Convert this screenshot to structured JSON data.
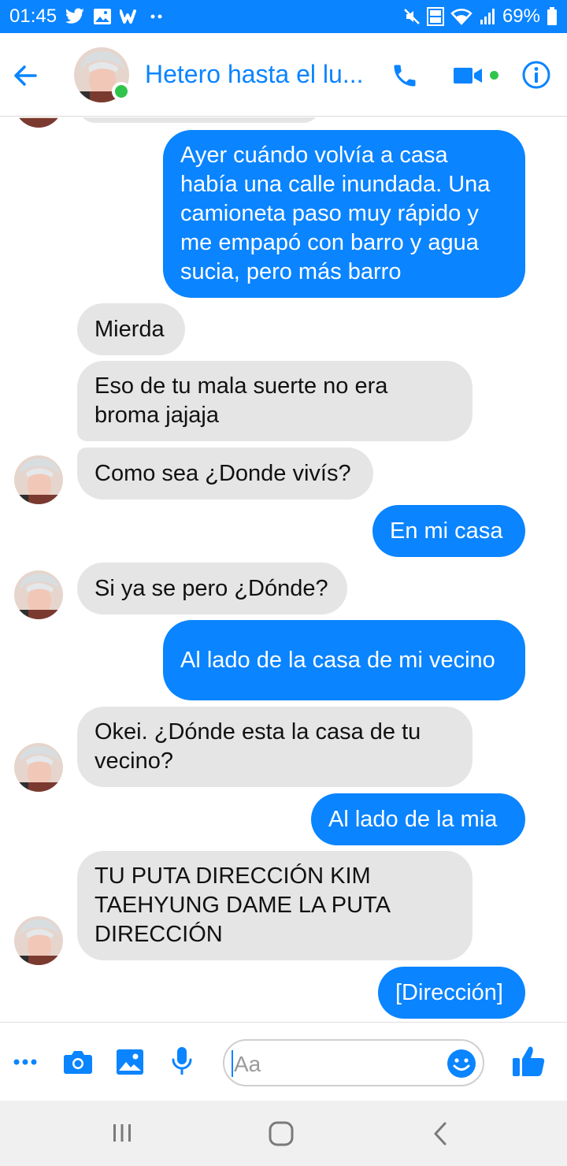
{
  "status_bar": {
    "time": "01:45",
    "icons_left": [
      "twitter-icon",
      "gallery-icon",
      "wattpad-icon",
      "more-notifications-icon"
    ],
    "icons_right": [
      "mute-icon",
      "volte-icon",
      "wifi-icon",
      "signal-icon"
    ],
    "battery": "69%"
  },
  "header": {
    "title": "Hetero hasta el lu...",
    "online": true
  },
  "messages": [
    {
      "from": "me",
      "text": "Ayer cuándo volvía a casa había una calle inundada. Una camioneta paso muy rápido y me empapó con barro y agua sucia, pero más barro"
    },
    {
      "from": "them",
      "text": "Mierda"
    },
    {
      "from": "them",
      "text": "Eso de tu mala suerte no era broma jajaja"
    },
    {
      "from": "them",
      "text": "Como sea ¿Donde vivís?"
    },
    {
      "from": "me",
      "text": "En mi casa"
    },
    {
      "from": "them",
      "text": "Si ya se pero ¿Dónde?"
    },
    {
      "from": "me",
      "text": "Al lado de la casa de mi vecino"
    },
    {
      "from": "them",
      "text": "Okei. ¿Dónde esta la casa de tu vecino?"
    },
    {
      "from": "me",
      "text": "Al lado de la mia"
    },
    {
      "from": "them",
      "text": "TU PUTA DIRECCIÓN KIM TAEHYUNG DAME LA PUTA DIRECCIÓN"
    },
    {
      "from": "me",
      "text": "[Dirección]"
    }
  ],
  "composer": {
    "placeholder": "Aa",
    "icons": [
      "more-icon",
      "camera-icon",
      "image-icon",
      "microphone-icon",
      "emoji-icon",
      "like-icon"
    ]
  },
  "colors": {
    "accent": "#0a84ff",
    "received_bubble": "#e5e5e5",
    "online": "#31c44d"
  }
}
